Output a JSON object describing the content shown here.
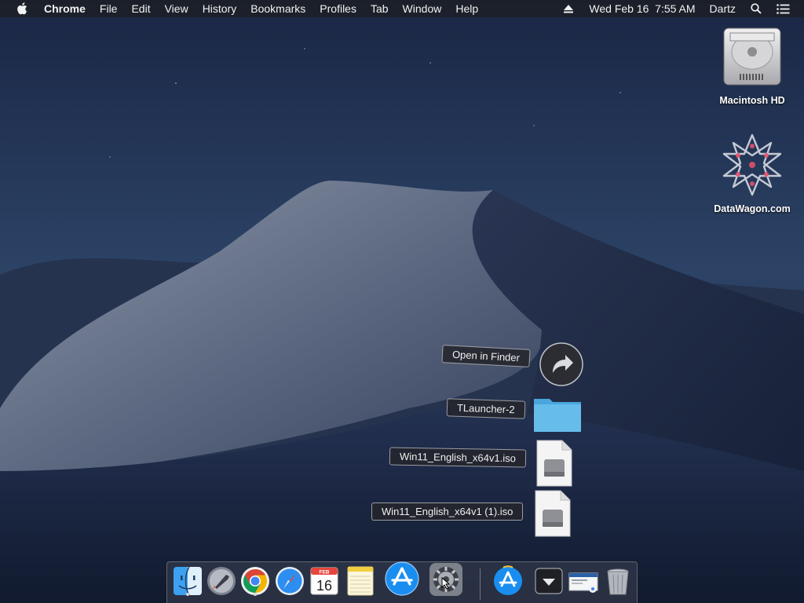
{
  "menubar": {
    "app_name": "Chrome",
    "menus": [
      "File",
      "Edit",
      "View",
      "History",
      "Bookmarks",
      "Profiles",
      "Tab",
      "Window",
      "Help"
    ],
    "datetime": "Wed Feb 16  7:55 AM",
    "user": "Dartz"
  },
  "desktop": {
    "icons": [
      {
        "label": "Macintosh HD",
        "icon": "hard-drive-icon"
      },
      {
        "label": "DataWagon.com",
        "icon": "datawagon-logo-icon"
      }
    ]
  },
  "stack": {
    "open_label": "Open in Finder",
    "items": [
      {
        "label": "TLauncher-2",
        "icon": "folder-icon"
      },
      {
        "label": "Win11_English_x64v1.iso",
        "icon": "disk-image-icon"
      },
      {
        "label": "Win11_English_x64v1 (1).iso",
        "icon": "disk-image-icon"
      }
    ]
  },
  "dock": {
    "items": [
      {
        "name": "Finder",
        "icon": "finder-icon",
        "running": true
      },
      {
        "name": "Launchpad",
        "icon": "launchpad-icon",
        "running": false
      },
      {
        "name": "Google Chrome",
        "icon": "chrome-icon",
        "running": true
      },
      {
        "name": "Safari",
        "icon": "safari-icon",
        "running": false
      },
      {
        "name": "Calendar",
        "icon": "calendar-icon",
        "running": false,
        "month": "FEB",
        "day": "16"
      },
      {
        "name": "Notes",
        "icon": "notes-icon",
        "running": false
      },
      {
        "name": "App Store",
        "icon": "app-store-icon",
        "running": false
      },
      {
        "name": "System Preferences",
        "icon": "gear-icon",
        "running": false
      },
      {
        "name": "App Store",
        "icon": "app-store-icon",
        "running": false
      },
      {
        "name": "Downloads",
        "icon": "downloads-stack-icon",
        "running": false
      },
      {
        "name": "Recent document",
        "icon": "document-preview-icon",
        "running": false
      },
      {
        "name": "Trash",
        "icon": "trash-icon",
        "running": false
      }
    ]
  },
  "colors": {
    "menubar_bg": "#1c1e24",
    "sky_top": "#1f3050",
    "dune_light": "#7c879a",
    "folder_blue": "#5ab4e6"
  }
}
